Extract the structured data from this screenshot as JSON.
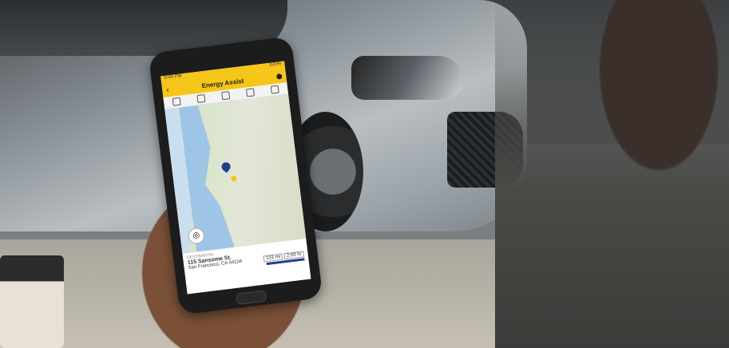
{
  "app": {
    "status_time": "9:48 PM",
    "status_battery": "100%",
    "title": "Energy Assist",
    "back_icon": "back-arrow-icon",
    "toolbar_icons": [
      "search-icon",
      "charger-icon",
      "plug-icon",
      "car-icon",
      "settings-icon"
    ]
  },
  "destination": {
    "label": "DESTINATION",
    "address": "115 Sansome St.",
    "city": "San Francisco, CA 94104",
    "miles": "101 mi",
    "time": "2:08 hr"
  },
  "colors": {
    "accent": "#f5c518",
    "pin": "#1f3f8f"
  }
}
